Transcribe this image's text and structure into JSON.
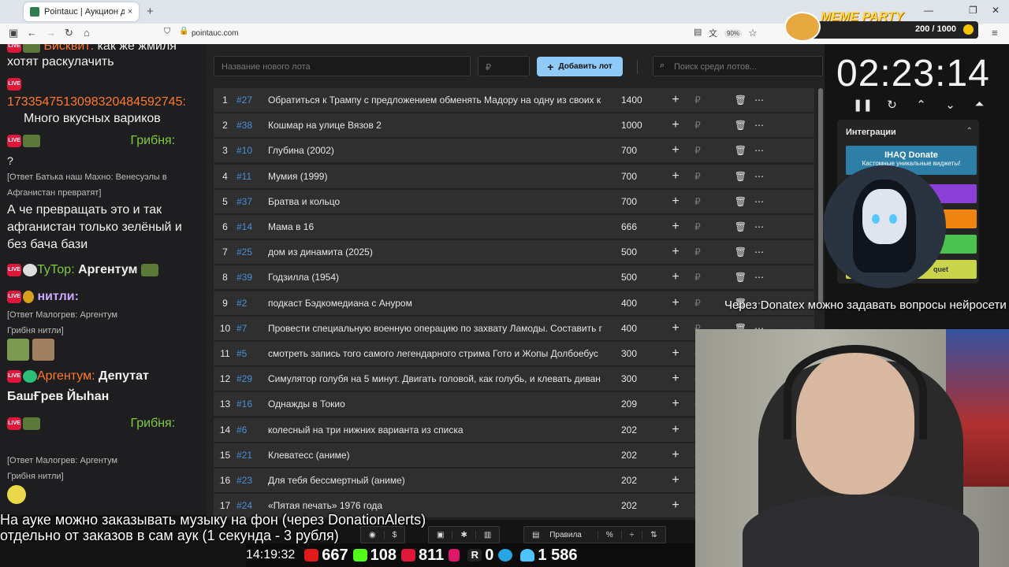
{
  "browser": {
    "tab_title": "Pointauc | Аукцион для стриме",
    "url": "pointauc.com",
    "zoom": "90%"
  },
  "meme_party": {
    "title": "MEME PARTY",
    "count": "200 / 1000"
  },
  "chat": [
    {
      "kind": "msg",
      "user": "Бисквит:",
      "text": "как же жмиля"
    },
    {
      "kind": "text",
      "text": "хотят раскулачить"
    },
    {
      "kind": "text",
      "text": "1733547513098320484592745:"
    },
    {
      "kind": "text",
      "text": "Много вкусных вариков"
    },
    {
      "kind": "user",
      "user": "Гриб̈ня:"
    },
    {
      "kind": "small",
      "text": "[Ответ Батька наш Махно: Венесуэлы в"
    },
    {
      "kind": "small",
      "text": "Афганистан превратят]"
    },
    {
      "kind": "text",
      "text": "А че превращать это и так"
    },
    {
      "kind": "text",
      "text": "афганистан только зелёный и"
    },
    {
      "kind": "text",
      "text": "без бача бази"
    },
    {
      "kind": "user",
      "user": "ТуТор:",
      "text": "Аргентум"
    },
    {
      "kind": "user",
      "user": "нитли:"
    },
    {
      "kind": "small",
      "text": "[Ответ Малогрев: Аргентум"
    },
    {
      "kind": "small",
      "text": "Гриб̈ня       нитли]"
    },
    {
      "kind": "user",
      "user": "Аргентум:",
      "text": "Депутат"
    },
    {
      "kind": "text",
      "text": "БашҒрев Йыһан"
    },
    {
      "kind": "user",
      "user": "Гриб̈ня:"
    },
    {
      "kind": "small",
      "text": "[Ответ Малогрев: Аргентум"
    },
    {
      "kind": "small",
      "text": "Гриб̈ня       нитли]"
    }
  ],
  "auction": {
    "new_lot_placeholder": "Название нового лота",
    "currency_placeholder": "₽",
    "add_lot_label": "Добавить лот",
    "search_placeholder": "Поиск среди лотов...",
    "lots": [
      {
        "n": "1",
        "id": "#27",
        "title": "Обратиться к Трампу с предложением обменять Мадору на одну из своих к",
        "amount": "1400"
      },
      {
        "n": "2",
        "id": "#38",
        "title": "Кошмар на улице Вязов 2",
        "amount": "1000"
      },
      {
        "n": "3",
        "id": "#10",
        "title": "Глубина (2002)",
        "amount": "700"
      },
      {
        "n": "4",
        "id": "#11",
        "title": "Мумия (1999)",
        "amount": "700"
      },
      {
        "n": "5",
        "id": "#37",
        "title": "Братва и кольцо",
        "amount": "700"
      },
      {
        "n": "6",
        "id": "#14",
        "title": "Мама в 16",
        "amount": "666"
      },
      {
        "n": "7",
        "id": "#25",
        "title": "дом из динамита (2025)",
        "amount": "500"
      },
      {
        "n": "8",
        "id": "#39",
        "title": "Годзилла (1954)",
        "amount": "500"
      },
      {
        "n": "9",
        "id": "#2",
        "title": "подкаст Бэдкомедиана с Ануром",
        "amount": "400"
      },
      {
        "n": "10",
        "id": "#7",
        "title": "Провести специальную военную операцию по захвату Ламоды. Составить г",
        "amount": "400"
      },
      {
        "n": "11",
        "id": "#5",
        "title": "смотреть запись того самого легендарного стрима Гото и Жопы Долбоебус",
        "amount": "300"
      },
      {
        "n": "12",
        "id": "#29",
        "title": "Симулятор голубя на 5 минут. Двигать головой, как голубь, и клевать диван",
        "amount": "300"
      },
      {
        "n": "13",
        "id": "#16",
        "title": "Однажды в Токио",
        "amount": "209"
      },
      {
        "n": "14",
        "id": "#6",
        "title": "колесный на три нижних варианта из списка",
        "amount": "202"
      },
      {
        "n": "15",
        "id": "#21",
        "title": "Клеватесс (аниме)",
        "amount": "202"
      },
      {
        "n": "16",
        "id": "#23",
        "title": "Для тебя бессмертный (аниме)",
        "amount": "202"
      },
      {
        "n": "17",
        "id": "#24",
        "title": "«Пятая печать» 1976 года",
        "amount": "202"
      }
    ]
  },
  "timer": "02:23:14",
  "integrations": {
    "title": "Интеграции",
    "ihaq": "IHAQ Donate",
    "ihaq_sub": "Кастомные уникальные виджеты!",
    "extra": "quet"
  },
  "overlay": {
    "donatex": "Через Donatex можно задавать вопросы нейросети",
    "music_line1": "На ауке можно заказывать музыку на фон (через DonationAlerts)",
    "music_line2": "отдельно от заказов в сам аук (1 секунда - 3 рубля)"
  },
  "toolbar": {
    "rules": "Правила"
  },
  "stats": {
    "time": "14:19:32",
    "youtube": "667",
    "kick": "108",
    "live": "811",
    "rutube": "0",
    "viewers": "1 586"
  }
}
